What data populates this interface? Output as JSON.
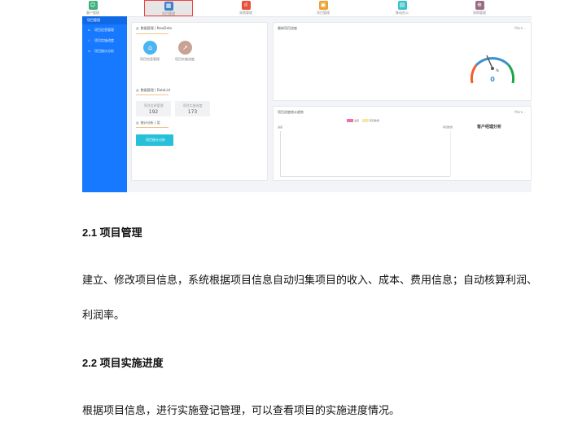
{
  "app": {
    "nav": [
      {
        "label": "客户管理",
        "icon": "user-circle-icon",
        "color": "#3db17d",
        "active": false
      },
      {
        "label": "项目管理",
        "icon": "calendar-icon",
        "color": "#3f80c8",
        "active": true
      },
      {
        "label": "采购管理",
        "icon": "chart-icon",
        "color": "#e8503a",
        "active": false
      },
      {
        "label": "项目管理",
        "icon": "folder-icon",
        "color": "#f0a030",
        "active": false
      },
      {
        "label": "移动办公",
        "icon": "book-icon",
        "color": "#38c1c9",
        "active": false
      },
      {
        "label": "采购管理",
        "icon": "cart-icon",
        "color": "#9b6b84",
        "active": false
      }
    ],
    "sidebar": {
      "title": "项目管理",
      "items": [
        {
          "label": "项目信息管理",
          "icon": "home-icon"
        },
        {
          "label": "项目实施进度",
          "icon": "check-icon"
        },
        {
          "label": "项目统计分析",
          "icon": "list-icon"
        }
      ]
    },
    "newdata": {
      "title": "数据管理 | NewData",
      "items": [
        {
          "label": "项目信息管理",
          "icon": "house-icon",
          "color": "#4db4f2"
        },
        {
          "label": "项目实施进度",
          "icon": "trend-icon",
          "color": "#c8a294"
        }
      ]
    },
    "datalist": {
      "title": "数据管理 | DataList",
      "stats": [
        {
          "label": "项目信息管理",
          "value": "192"
        },
        {
          "label": "项目实施进度",
          "value": "173"
        }
      ]
    },
    "stats_section": {
      "title": "统计分析 | 用",
      "button": "项目统计分析"
    },
    "gauge": {
      "title": "最新项目进度",
      "more": "More...",
      "value": "0",
      "unit": "%"
    },
    "trend": {
      "title": "项目进度统计趋势",
      "more": "More...",
      "legend": [
        {
          "label": "进度",
          "color": "#f06fa8"
        },
        {
          "label": "项目数量",
          "color": "#f6e7a5"
        }
      ],
      "left_label": "进度",
      "right_label": "项目数量",
      "chart_title": "客户经理分析"
    }
  },
  "doc": {
    "h1": "2.1 项目管理",
    "p1_line1": "建立、修改项目信息，系统根据项目信息自动归集项目的收入、成本、费用信息；自动核算利润、",
    "p1_line2": "利润率。",
    "h2": "2.2 项目实施进度",
    "p2": "根据项目信息，进行实施登记管理，可以查看项目的实施进度情况。"
  }
}
